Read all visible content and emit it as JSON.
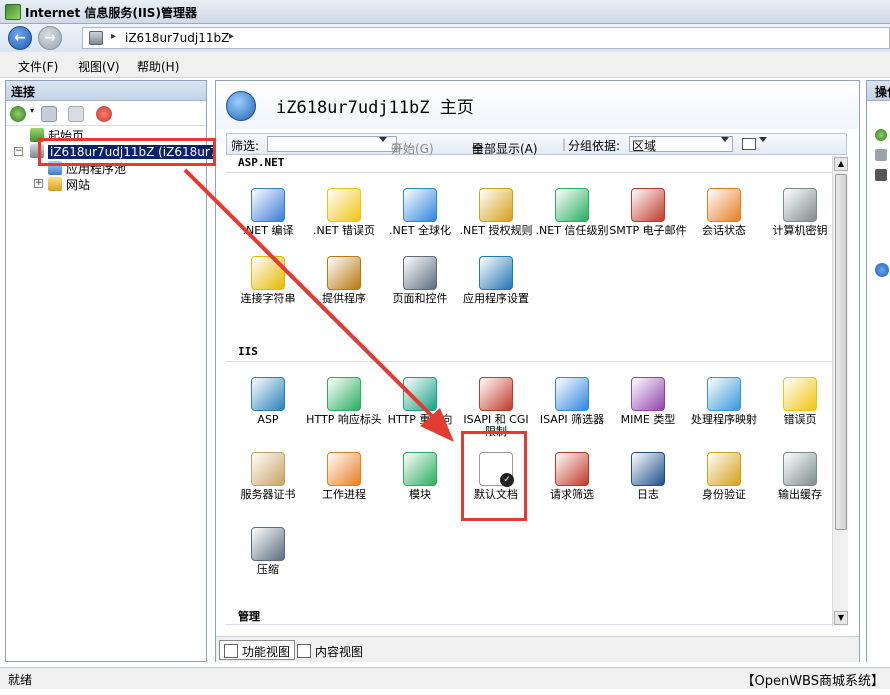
{
  "window": {
    "title": "Internet 信息服务(IIS)管理器"
  },
  "address": {
    "crumb": "iZ618ur7udj11bZ"
  },
  "menu": [
    "文件(F)",
    "视图(V)",
    "帮助(H)"
  ],
  "connections": {
    "header": "连接",
    "tree": {
      "start": "起始页",
      "server": "iZ618ur7udj11bZ (iZ618ur7u",
      "app_pools": "应用程序池",
      "sites": "网站"
    }
  },
  "home": {
    "title": "iZ618ur7udj11bZ 主页",
    "filter_label": "筛选:",
    "start_label": "开始(G)",
    "show_all_label": "全部显示(A)",
    "group_by_label": "分组依据:",
    "group_by_value": "区域"
  },
  "groups": [
    {
      "name": "ASP.NET",
      "features": [
        {
          "label": ".NET 编译",
          "icon": "download-arrow-icon",
          "color": "#3a7bd5"
        },
        {
          "label": ".NET 错误页",
          "icon": "warning-404-icon",
          "color": "#f1c40f"
        },
        {
          "label": ".NET 全球化",
          "icon": "globe-icon",
          "color": "#2e86de"
        },
        {
          "label": ".NET 授权规则",
          "icon": "lock-document-icon",
          "color": "#d4a017"
        },
        {
          "label": ".NET 信任级别",
          "icon": "globe-check-icon",
          "color": "#27ae60"
        },
        {
          "label": "SMTP 电子邮件",
          "icon": "email-icon",
          "color": "#c0392b"
        },
        {
          "label": "会话状态",
          "icon": "user-session-icon",
          "color": "#e67e22"
        },
        {
          "label": "计算机密钥",
          "icon": "server-key-icon",
          "color": "#7f8c8d"
        },
        {
          "label": "连接字符串",
          "icon": "database-icon",
          "color": "#e6b800"
        },
        {
          "label": "提供程序",
          "icon": "provider-user-icon",
          "color": "#b9770e"
        },
        {
          "label": "页面和控件",
          "icon": "page-controls-icon",
          "color": "#5d6d7e"
        },
        {
          "label": "应用程序设置",
          "icon": "app-settings-icon",
          "color": "#1f77b4"
        }
      ]
    },
    {
      "name": "IIS",
      "features": [
        {
          "label": "ASP",
          "icon": "asp-globe-icon",
          "color": "#2980b9"
        },
        {
          "label": "HTTP 响应标头",
          "icon": "http-headers-icon",
          "color": "#27ae60"
        },
        {
          "label": "HTTP 重定向",
          "icon": "redirect-icon",
          "color": "#16a085"
        },
        {
          "label": "ISAPI 和 CGI 限制",
          "icon": "cgi-restrict-icon",
          "color": "#c0392b"
        },
        {
          "label": "ISAPI 筛选器",
          "icon": "filter-funnel-icon",
          "color": "#2e86de"
        },
        {
          "label": "MIME 类型",
          "icon": "music-note-icon",
          "color": "#8e44ad"
        },
        {
          "label": "处理程序映射",
          "icon": "handler-map-icon",
          "color": "#3498db"
        },
        {
          "label": "错误页",
          "icon": "error-404-icon",
          "color": "#f1c40f"
        },
        {
          "label": "服务器证书",
          "icon": "certificate-icon",
          "color": "#c8a165"
        },
        {
          "label": "工作进程",
          "icon": "worker-gear-icon",
          "color": "#e67e22"
        },
        {
          "label": "模块",
          "icon": "module-icon",
          "color": "#27ae60"
        },
        {
          "label": "默认文档",
          "icon": "default-document-icon",
          "color": "#333333"
        },
        {
          "label": "请求筛选",
          "icon": "request-filter-icon",
          "color": "#c0392b"
        },
        {
          "label": "日志",
          "icon": "log-book-icon",
          "color": "#1f4e8c"
        },
        {
          "label": "身份验证",
          "icon": "auth-user-icon",
          "color": "#d4a017"
        },
        {
          "label": "输出缓存",
          "icon": "output-cache-icon",
          "color": "#7f8c8d"
        },
        {
          "label": "压缩",
          "icon": "compress-clamp-icon",
          "color": "#5d6d7e"
        }
      ]
    },
    {
      "name": "管理",
      "features": []
    }
  ],
  "tabs": {
    "features_view": "功能视图",
    "content_view": "内容视图"
  },
  "actions": {
    "header": "操作"
  },
  "status": {
    "left": "就绪",
    "right": "【OpenWBS商城系统】"
  },
  "accent": {
    "selection": "#0a246a",
    "highlight": "#e53a2f"
  }
}
